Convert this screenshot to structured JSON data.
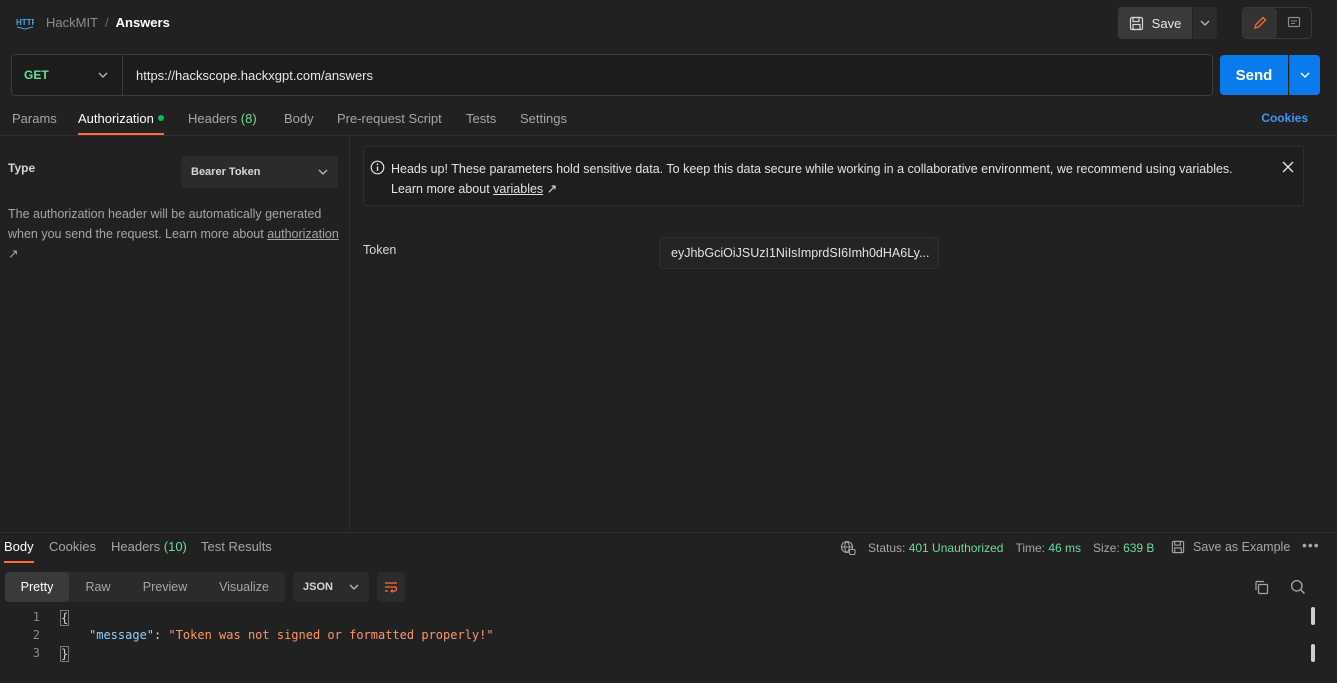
{
  "breadcrumb": {
    "workspace": "HackMIT",
    "separator": "/",
    "request": "Answers"
  },
  "toolbar": {
    "save_label": "Save"
  },
  "request": {
    "method": "GET",
    "url": "https://hackscope.hackxgpt.com/answers",
    "send_label": "Send"
  },
  "req_tabs": {
    "params": "Params",
    "authorization": "Authorization",
    "headers": "Headers",
    "headers_count": "(8)",
    "body": "Body",
    "prerequest": "Pre-request Script",
    "tests": "Tests",
    "settings": "Settings",
    "cookies": "Cookies"
  },
  "auth": {
    "type_label": "Type",
    "type_value": "Bearer Token",
    "desc_prefix": "The authorization header will be automatically generated when you send the request. Learn more about ",
    "desc_link": "authorization",
    "link_arrow": "↗"
  },
  "banner": {
    "text": "Heads up! These parameters hold sensitive data. To keep this data secure while working in a collaborative environment, we recommend using variables.",
    "learn_prefix": "Learn more about ",
    "learn_link": "variables",
    "link_arrow": "↗"
  },
  "token": {
    "label": "Token",
    "value": "eyJhbGciOiJSUzI1NiIsImprdSI6Imh0dHA6Ly..."
  },
  "response": {
    "tabs": {
      "body": "Body",
      "cookies": "Cookies",
      "headers": "Headers",
      "headers_count": "(10)",
      "test_results": "Test Results"
    },
    "status_label": "Status:",
    "status_value": "401 Unauthorized",
    "time_label": "Time:",
    "time_value": "46 ms",
    "size_label": "Size:",
    "size_value": "639 B",
    "save_example": "Save as Example",
    "more": "•••",
    "formats": [
      "Pretty",
      "Raw",
      "Preview",
      "Visualize"
    ],
    "language": "JSON",
    "lines": {
      "n1": "1",
      "n2": "2",
      "n3": "3",
      "open": "{",
      "key": "\"message\"",
      "colon": ": ",
      "value": "\"Token was not signed or formatted properly!\"",
      "close": "}"
    }
  },
  "colors": {
    "accent_orange": "#ff6c37",
    "send_blue": "#097bed",
    "method_green": "#6bdd9a",
    "link_blue": "#3f97f2"
  }
}
